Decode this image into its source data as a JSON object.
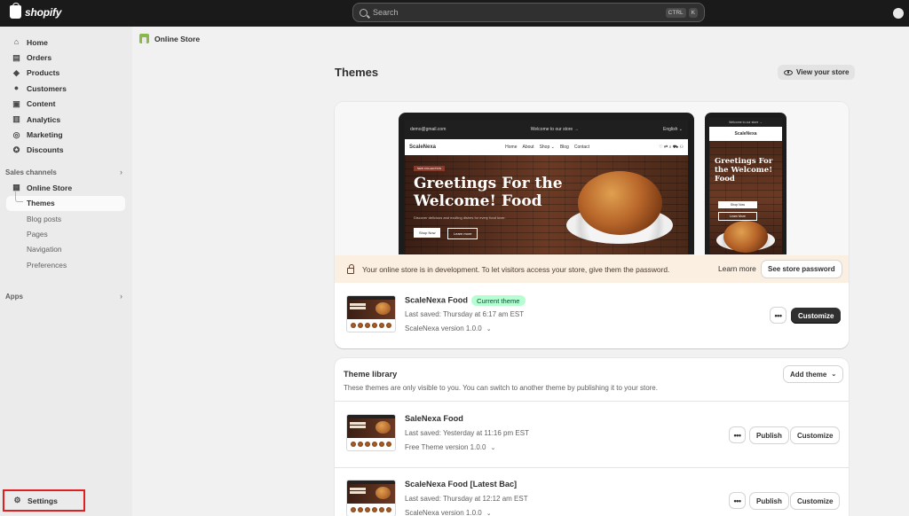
{
  "topbar": {
    "brand": "shopify",
    "search_placeholder": "Search",
    "shortcut_keys": [
      "CTRL",
      "K"
    ]
  },
  "sidebar": {
    "items": [
      {
        "label": "Home",
        "icon": "home-icon"
      },
      {
        "label": "Orders",
        "icon": "inbox-icon"
      },
      {
        "label": "Products",
        "icon": "tag-icon"
      },
      {
        "label": "Customers",
        "icon": "person-icon"
      },
      {
        "label": "Content",
        "icon": "content-icon"
      },
      {
        "label": "Analytics",
        "icon": "chart-icon"
      },
      {
        "label": "Marketing",
        "icon": "target-icon"
      },
      {
        "label": "Discounts",
        "icon": "discount-icon"
      }
    ],
    "sales_channels_label": "Sales channels",
    "online_store_label": "Online Store",
    "sub_items": [
      "Themes",
      "Blog posts",
      "Pages",
      "Navigation",
      "Preferences"
    ],
    "apps_label": "Apps",
    "settings_label": "Settings"
  },
  "breadcrumb": {
    "label": "Online Store"
  },
  "page": {
    "title": "Themes",
    "view_store_label": "View your store"
  },
  "preview": {
    "laptop": {
      "email": "demo@gmail.com",
      "announcement": "Welcome to our store →",
      "language": "English ⌄",
      "logo": "ScaleNexa",
      "nav_links": [
        "Home",
        "About",
        "Shop ⌄",
        "Blog",
        "Contact"
      ],
      "hero_tag": "NEW COLLECTION",
      "hero_title": "Greetings For the Welcome! Food",
      "hero_subtitle": "Discover delicious and exciting dishes for every food lover.",
      "shop_now": "Shop Now",
      "learn_more": "Learn more"
    },
    "phone": {
      "announcement": "Welcome to our store →",
      "logo": "ScaleNexa",
      "hero_title": "Greetings For the Welcome! Food",
      "shop_now": "Shop Now",
      "learn_more": "Learn More"
    }
  },
  "dev_banner": {
    "message": "Your online store is in development. To let visitors access your store, give them the password.",
    "learn_more": "Learn more",
    "button": "See store password"
  },
  "current_theme": {
    "name": "ScaleNexa Food",
    "badge": "Current theme",
    "last_saved": "Last saved: Thursday at 6:17 am EST",
    "version": "ScaleNexa version 1.0.0",
    "more_label": "•••",
    "customize_label": "Customize"
  },
  "library": {
    "title": "Theme library",
    "subtitle": "These themes are only visible to you. You can switch to another theme by publishing it to your store.",
    "add_theme_label": "Add theme",
    "themes": [
      {
        "name": "SaleNexa Food",
        "last_saved": "Last saved: Yesterday at 11:16 pm EST",
        "version": "Free Theme version 1.0.0",
        "more_label": "•••",
        "publish_label": "Publish",
        "customize_label": "Customize"
      },
      {
        "name": "ScaleNexa Food [Latest Bac]",
        "last_saved": "Last saved: Thursday at 12:12 am EST",
        "version": "ScaleNexa version 1.0.0",
        "more_label": "•••",
        "publish_label": "Publish",
        "customize_label": "Customize"
      }
    ]
  },
  "colors": {
    "topbar": "#1a1a1a",
    "sidebar": "#ebebeb",
    "badge_bg": "#b4fed2",
    "banner_bg": "#fbefe2",
    "highlight_border": "#e02020"
  }
}
